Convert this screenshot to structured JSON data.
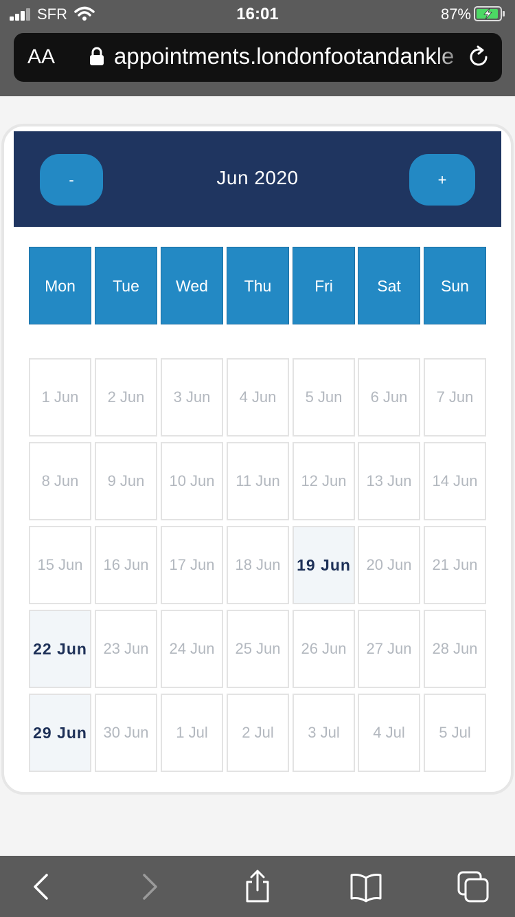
{
  "status_bar": {
    "carrier": "SFR",
    "time": "16:01",
    "battery": "87%"
  },
  "browser": {
    "text_size_label": "AA",
    "url": "appointments.londonfootandankle"
  },
  "calendar": {
    "prev_label": "-",
    "next_label": "+",
    "month_title": "Jun 2020",
    "weekdays": [
      "Mon",
      "Tue",
      "Wed",
      "Thu",
      "Fri",
      "Sat",
      "Sun"
    ],
    "weeks": [
      [
        {
          "label": "1 Jun",
          "available": false
        },
        {
          "label": "2 Jun",
          "available": false
        },
        {
          "label": "3 Jun",
          "available": false
        },
        {
          "label": "4 Jun",
          "available": false
        },
        {
          "label": "5 Jun",
          "available": false
        },
        {
          "label": "6 Jun",
          "available": false
        },
        {
          "label": "7 Jun",
          "available": false
        }
      ],
      [
        {
          "label": "8 Jun",
          "available": false
        },
        {
          "label": "9 Jun",
          "available": false
        },
        {
          "label": "10 Jun",
          "available": false
        },
        {
          "label": "11 Jun",
          "available": false
        },
        {
          "label": "12 Jun",
          "available": false
        },
        {
          "label": "13 Jun",
          "available": false
        },
        {
          "label": "14 Jun",
          "available": false
        }
      ],
      [
        {
          "label": "15 Jun",
          "available": false
        },
        {
          "label": "16 Jun",
          "available": false
        },
        {
          "label": "17 Jun",
          "available": false
        },
        {
          "label": "18 Jun",
          "available": false
        },
        {
          "label": "19 Jun",
          "available": true
        },
        {
          "label": "20 Jun",
          "available": false
        },
        {
          "label": "21 Jun",
          "available": false
        }
      ],
      [
        {
          "label": "22 Jun",
          "available": true
        },
        {
          "label": "23 Jun",
          "available": false
        },
        {
          "label": "24 Jun",
          "available": false
        },
        {
          "label": "25 Jun",
          "available": false
        },
        {
          "label": "26 Jun",
          "available": false
        },
        {
          "label": "27 Jun",
          "available": false
        },
        {
          "label": "28 Jun",
          "available": false
        }
      ],
      [
        {
          "label": "29 Jun",
          "available": true
        },
        {
          "label": "30 Jun",
          "available": false
        },
        {
          "label": "1 Jul",
          "available": false
        },
        {
          "label": "2 Jul",
          "available": false
        },
        {
          "label": "3 Jul",
          "available": false
        },
        {
          "label": "4 Jul",
          "available": false
        },
        {
          "label": "5 Jul",
          "available": false
        }
      ]
    ]
  },
  "toolbar": {
    "icons": [
      "back-icon",
      "forward-icon",
      "share-icon",
      "bookmarks-icon",
      "tabs-icon"
    ]
  },
  "colors": {
    "header_bg": "#1f3560",
    "accent": "#2389c4",
    "available_text": "#1d3057",
    "disabled_text": "#b3b8bf"
  }
}
